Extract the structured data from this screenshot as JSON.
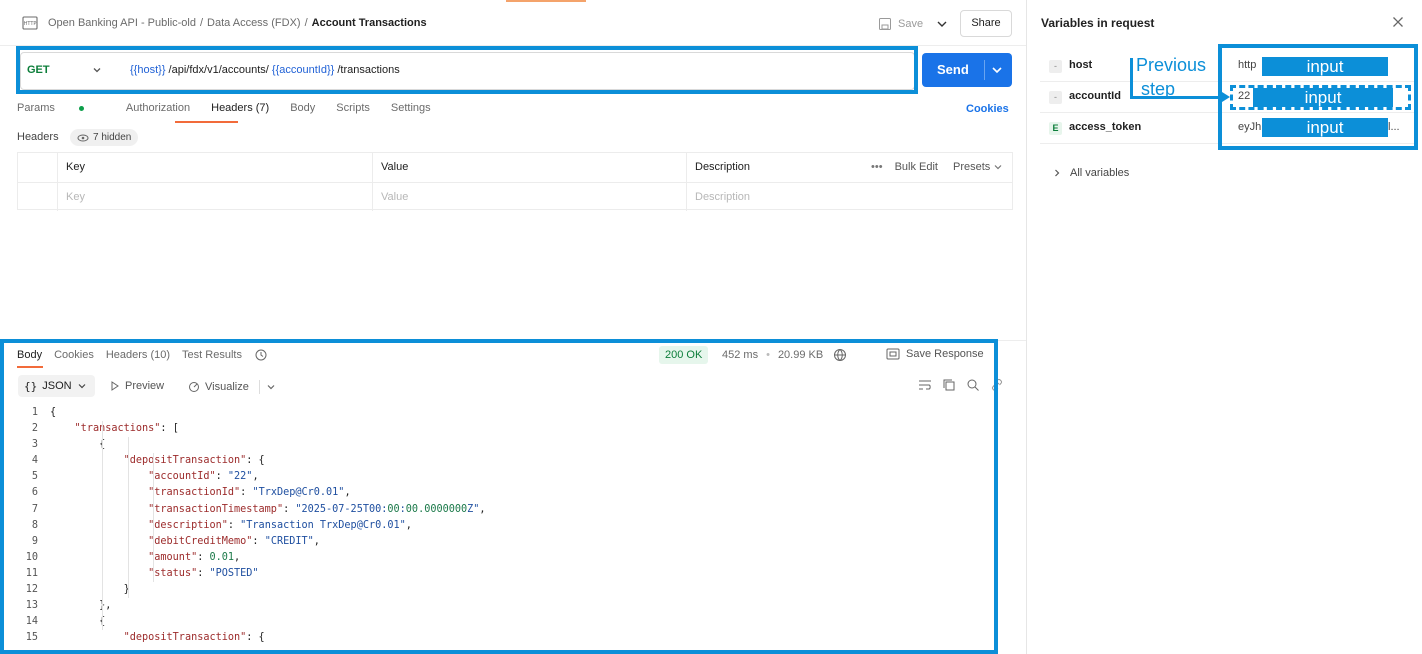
{
  "breadcrumb": {
    "collection": "Open Banking API - Public-old",
    "folder": "Data Access (FDX)",
    "current": "Account Transactions"
  },
  "toolbar": {
    "save_label": "Save",
    "share_label": "Share"
  },
  "request": {
    "method": "GET",
    "url_parts": [
      "{{host}}",
      " /api/fdx/v1/accounts/ ",
      "{{accountId}}",
      " /transactions"
    ],
    "send_label": "Send",
    "cookies_label": "Cookies"
  },
  "request_tabs": [
    "Params",
    "Authorization",
    "Headers (7)",
    "Body",
    "Scripts",
    "Settings"
  ],
  "headers_section": {
    "label": "Headers",
    "hidden": "7 hidden",
    "columns": [
      "Key",
      "Value",
      "Description"
    ],
    "placeholders": [
      "Key",
      "Value",
      "Description"
    ],
    "bulk_edit": "Bulk Edit",
    "presets": "Presets"
  },
  "response": {
    "tabs": [
      "Body",
      "Cookies",
      "Headers (10)",
      "Test Results"
    ],
    "status": "200 OK",
    "time": "452 ms",
    "size": "20.99 KB",
    "save_response": "Save Response",
    "format": "JSON",
    "preview": "Preview",
    "visualize": "Visualize",
    "code_lines": [
      "{",
      "    \"transactions\": [",
      "        {",
      "            \"depositTransaction\": {",
      "                \"accountId\": \"22\",",
      "                \"transactionId\": \"TrxDep@Cr0.01\",",
      "                \"transactionTimestamp\": \"2025-07-25T00:00:00.0000000Z\",",
      "                \"description\": \"Transaction TrxDep@Cr0.01\",",
      "                \"debitCreditMemo\": \"CREDIT\",",
      "                \"amount\": 0.01,",
      "                \"status\": \"POSTED\"",
      "            }",
      "        },",
      "        {",
      "            \"depositTransaction\": {"
    ]
  },
  "variables_panel": {
    "title": "Variables in request",
    "items": [
      {
        "badge": "-",
        "name": "host",
        "value": "http",
        "mask": "input"
      },
      {
        "badge": "-",
        "name": "accountId",
        "value": "22",
        "mask": "input"
      },
      {
        "badge": "E",
        "name": "access_token",
        "value": "eyJh",
        "tail": "l...",
        "mask": "input"
      }
    ],
    "all_variables": "All variables"
  },
  "annotation": {
    "previous_step": "Previous step",
    "line1": "Previous",
    "line2": "step"
  },
  "colors": {
    "accent": "#1a73e8",
    "highlight": "#0c8fd8",
    "active_tab": "#f26b3a",
    "success": "#0c7e3a"
  }
}
